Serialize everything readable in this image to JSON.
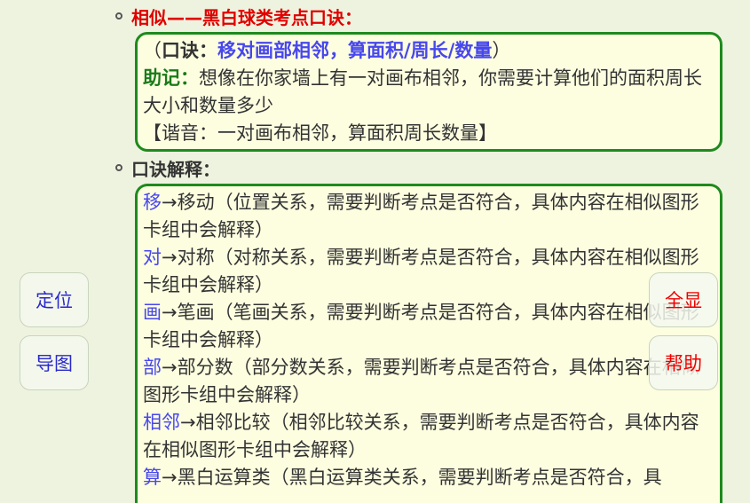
{
  "section1": {
    "title": "相似——黑白球类考点口诀：",
    "box": {
      "open_paren": "（",
      "mnemonic_label": "口诀：",
      "mnemonic_text": "移对画部相邻，算面积/周长/数量",
      "close_paren": "）",
      "helper_label": "助记：",
      "helper_text": "想像在你家墙上有一对画布相邻，你需要计算他们的面积周长大小和数量多少",
      "homophone": "【谐音：一对画布相邻，算面积周长数量】"
    }
  },
  "section2": {
    "title": "口诀解释：",
    "items": [
      {
        "key": "移",
        "text": "→移动（位置关系，需要判断考点是否符合，具体内容在相似图形卡组中会解释）"
      },
      {
        "key": "对",
        "text": "→对称（对称关系，需要判断考点是否符合，具体内容在相似图形卡组中会解释）"
      },
      {
        "key": "画",
        "text": "→笔画（笔画关系，需要判断考点是否符合，具体内容在相似图形卡组中会解释）"
      },
      {
        "key": "部",
        "text": "→部分数（部分数关系，需要判断考点是否符合，具体内容在相似图形卡组中会解释）"
      },
      {
        "key": "相邻",
        "text": "→相邻比较（相邻比较关系，需要判断考点是否符合，具体内容在相似图形卡组中会解释）"
      },
      {
        "key": "算",
        "text": "→黑白运算类（黑白运算类关系，需要判断考点是否符合，具"
      }
    ]
  },
  "buttons": {
    "locate": "定位",
    "mindmap": "导图",
    "show_all": "全显",
    "help": "帮助"
  }
}
